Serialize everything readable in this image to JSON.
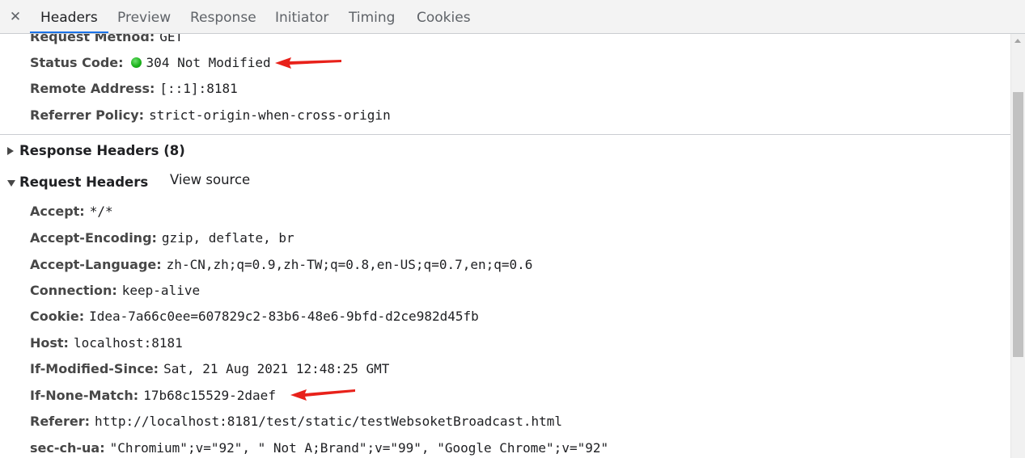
{
  "tabs": {
    "close_symbol": "✕",
    "items": [
      "Headers",
      "Preview",
      "Response",
      "Initiator",
      "Timing",
      "Cookies"
    ],
    "active": "Headers",
    "accent_color": "#1a73e8"
  },
  "general": {
    "request_method": {
      "name": "Request Method:",
      "value": "GET"
    },
    "status_code": {
      "name": "Status Code:",
      "value": "304 Not Modified",
      "indicator_color": "#1db41d"
    },
    "remote_address": {
      "name": "Remote Address:",
      "value": "[::1]:8181"
    },
    "referrer_policy": {
      "name": "Referrer Policy:",
      "value": "strict-origin-when-cross-origin"
    }
  },
  "response_headers": {
    "title": "Response Headers (8)",
    "expanded": false
  },
  "request_headers": {
    "title": "Request Headers",
    "expanded": true,
    "view_source": "View source",
    "items": [
      {
        "name": "Accept:",
        "value": "*/*"
      },
      {
        "name": "Accept-Encoding:",
        "value": "gzip, deflate, br"
      },
      {
        "name": "Accept-Language:",
        "value": "zh-CN,zh;q=0.9,zh-TW;q=0.8,en-US;q=0.7,en;q=0.6"
      },
      {
        "name": "Connection:",
        "value": "keep-alive"
      },
      {
        "name": "Cookie:",
        "value": "Idea-7a66c0ee=607829c2-83b6-48e6-9bfd-d2ce982d45fb"
      },
      {
        "name": "Host:",
        "value": "localhost:8181"
      },
      {
        "name": "If-Modified-Since:",
        "value": "Sat, 21 Aug 2021 12:48:25 GMT"
      },
      {
        "name": "If-None-Match:",
        "value": "17b68c15529-2daef"
      },
      {
        "name": "Referer:",
        "value": "http://localhost:8181/test/static/testWebsoketBroadcast.html"
      },
      {
        "name": "sec-ch-ua:",
        "value": "\"Chromium\";v=\"92\", \" Not A;Brand\";v=\"99\", \"Google Chrome\";v=\"92\""
      }
    ]
  },
  "annotations": {
    "arrow_color": "#e8211a"
  }
}
